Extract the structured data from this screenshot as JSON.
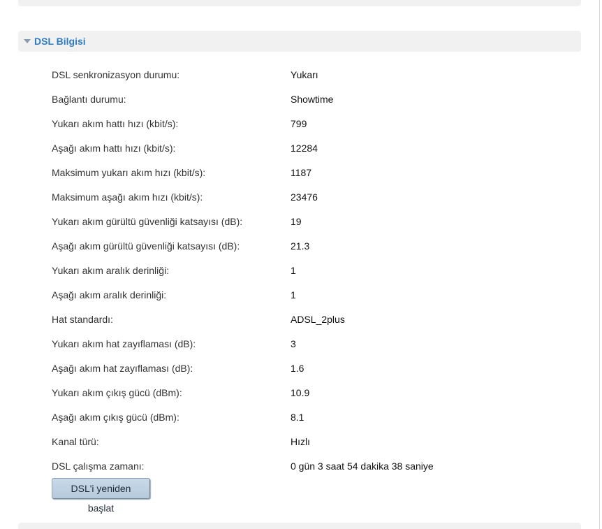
{
  "section": {
    "title": "DSL Bilgisi"
  },
  "rows": [
    {
      "label": "DSL senkronizasyon durumu:",
      "value": "Yukarı"
    },
    {
      "label": "Bağlantı durumu:",
      "value": "Showtime"
    },
    {
      "label": "Yukarı akım hattı hızı (kbit/s):",
      "value": "799"
    },
    {
      "label": "Aşağı akım hattı hızı (kbit/s):",
      "value": "12284"
    },
    {
      "label": "Maksimum yukarı akım hızı (kbit/s):",
      "value": "1187"
    },
    {
      "label": "Maksimum aşağı akım hızı (kbit/s):",
      "value": "23476"
    },
    {
      "label": "Yukarı akım gürültü güvenliği katsayısı (dB):",
      "value": "19"
    },
    {
      "label": "Aşağı akım gürültü güvenliği katsayısı (dB):",
      "value": "21.3"
    },
    {
      "label": "Yukarı akım aralık derinliği:",
      "value": "1"
    },
    {
      "label": "Aşağı akım aralık derinliği:",
      "value": "1"
    },
    {
      "label": "Hat standardı:",
      "value": "ADSL_2plus"
    },
    {
      "label": "Yukarı akım hat zayıflaması (dB):",
      "value": "3"
    },
    {
      "label": "Aşağı akım hat zayıflaması (dB):",
      "value": "1.6"
    },
    {
      "label": "Yukarı akım çıkış gücü (dBm):",
      "value": "10.9"
    },
    {
      "label": "Aşağı akım çıkış gücü (dBm):",
      "value": "8.1"
    },
    {
      "label": "Kanal türü:",
      "value": "Hızlı"
    },
    {
      "label": "DSL çalışma zamanı:",
      "value": "0 gün 3 saat 54 dakika 38 saniye"
    }
  ],
  "actions": {
    "restart_label": "DSL'i yeniden başlat"
  },
  "colors": {
    "header_text": "#2f7cc1",
    "panel_bg": "#f1f1f1",
    "button_bg": "#c3d5e6"
  },
  "icons": {
    "section_toggle": "caret-down-icon"
  }
}
